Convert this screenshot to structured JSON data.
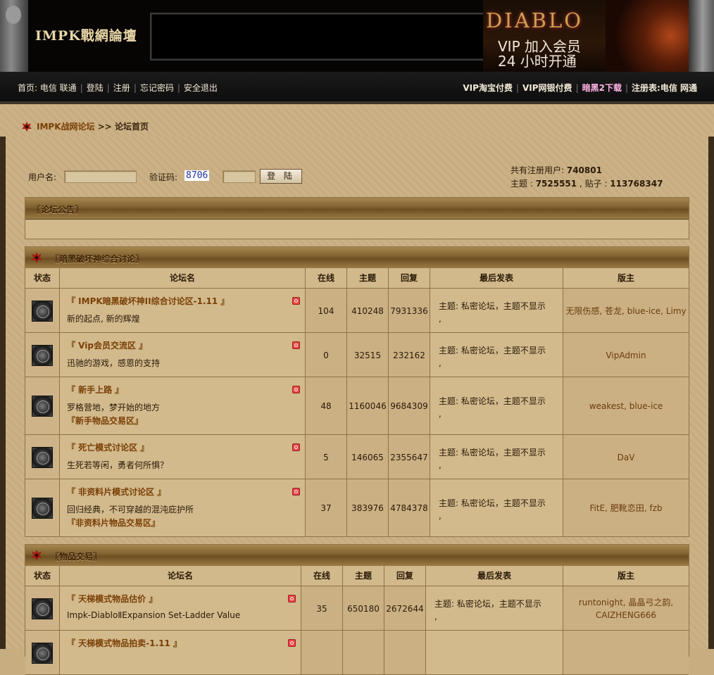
{
  "header": {
    "logo": "IMPK戰網論壇",
    "ad_title": "DIABLO",
    "ad_line1": "VIP 加入会员",
    "ad_line2": "24  小时开通"
  },
  "nav": {
    "left": [
      {
        "label": "首页: 电信 联通"
      },
      {
        "label": "登陆"
      },
      {
        "label": "注册"
      },
      {
        "label": "忘记密码"
      },
      {
        "label": "安全退出"
      }
    ],
    "right": [
      {
        "label": "VIP淘宝付费"
      },
      {
        "label": "VIP网银付费"
      },
      {
        "label": "暗黑2下载"
      },
      {
        "label": "注册表:电信  网通"
      }
    ]
  },
  "breadcrumb": {
    "site": "IMPK战网论坛",
    "arrow": ">>",
    "current": "论坛首页"
  },
  "login": {
    "username_label": "用户名:",
    "captcha_label": "验证码:",
    "captcha_value": "8706",
    "submit": "登 陆"
  },
  "stats": {
    "users_label": "共有注册用户: ",
    "users": "740801",
    "topics_label": "主题 : ",
    "topics": "7525551",
    "posts_label": " , 贴子 : ",
    "posts": "113768347"
  },
  "announcement": {
    "title": "〖论坛公告〗"
  },
  "columns": {
    "status": "状态",
    "forum": "论坛名",
    "online": "在线",
    "topics": "主题",
    "replies": "回复",
    "last": "最后发表",
    "mod": "版主"
  },
  "section1": {
    "title": "〖暗黑破坏神综合讨论〗",
    "forums": [
      {
        "name": "『 IMPK暗黑破坏神II综合讨论区-1.11 』",
        "desc": "新的起点, 新的辉煌",
        "sub": "",
        "online": "104",
        "topics": "410248",
        "replies": "7931336",
        "last": "主题: 私密论坛，主题不显示",
        "last2": ",",
        "mod": "无限伤感, 苍龙, blue-ice, Limy"
      },
      {
        "name": "『 Vip会员交流区 』",
        "desc": "迅驰的游戏，感恩的支持",
        "sub": "",
        "online": "0",
        "topics": "32515",
        "replies": "232162",
        "last": "主题: 私密论坛，主题不显示",
        "last2": ",",
        "mod": "VipAdmin"
      },
      {
        "name": "『 新手上路 』",
        "desc": "罗格营地，梦开始的地方",
        "sub": "『新手物品交易区』",
        "online": "48",
        "topics": "1160046",
        "replies": "9684309",
        "last": "主题: 私密论坛，主题不显示",
        "last2": ",",
        "mod": "weakest, blue-ice"
      },
      {
        "name": "『 死亡模式讨论区 』",
        "desc": "生死若等闲，勇者何所惧？",
        "sub": "",
        "online": "5",
        "topics": "146065",
        "replies": "2355647",
        "last": "主题: 私密论坛，主题不显示",
        "last2": ",",
        "mod": "DaV"
      },
      {
        "name": "『 非资料片模式讨论区 』",
        "desc": "回归经典，不可穿越的混沌庇护所",
        "sub": "『非资料片物品交易区』",
        "online": "37",
        "topics": "383976",
        "replies": "4784378",
        "last": "主题: 私密论坛，主题不显示",
        "last2": ",",
        "mod": "FitE, 肥靴恋田, fzb"
      }
    ]
  },
  "section2": {
    "title": "〖物品交易〗",
    "forums": [
      {
        "name": "『 天梯模式物品估价 』",
        "desc": "Impk-DiabloⅡExpansion Set-Ladder Value",
        "online": "35",
        "topics": "650180",
        "replies": "2672644",
        "last": "主题: 私密论坛，主题不显示",
        "last2": ",",
        "mod1": "runtonight, 晶晶弓之韵,",
        "mod2": "CAIZHENG666"
      },
      {
        "name": "『 天梯模式物品拍卖-1.11 』",
        "desc": "",
        "online": "",
        "topics": "",
        "replies": "",
        "last": "",
        "last2": "",
        "mod1": "",
        "mod2": ""
      }
    ]
  }
}
